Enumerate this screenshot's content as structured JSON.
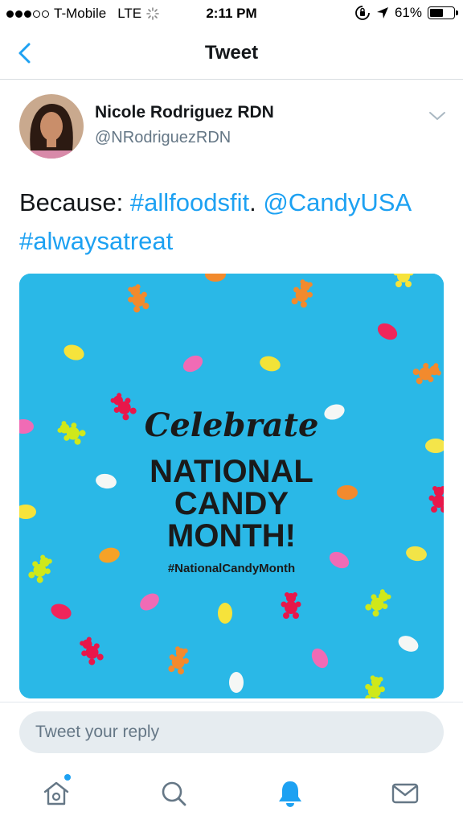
{
  "status_bar": {
    "carrier": "T-Mobile",
    "network": "LTE",
    "time": "2:11 PM",
    "battery": "61%",
    "battery_level": 0.61
  },
  "nav": {
    "title": "Tweet",
    "back_icon": "chevron-left-icon"
  },
  "tweet": {
    "display_name": "Nicole Rodriguez RDN",
    "handle": "@NRodriguezRDN",
    "text": {
      "prefix": "Because: ",
      "tag1": "#allfoodsfit",
      "sep": ". ",
      "mention": "@CandyUSA",
      "tag2": "#alwaysatreat"
    },
    "media": {
      "script_word": "Celebrate",
      "line1": "NATIONAL",
      "line2": "CANDY",
      "line3": "MONTH!",
      "hashtag": "#NationalCandyMonth",
      "background_color": "#2ab8e7"
    }
  },
  "reply": {
    "placeholder": "Tweet your reply"
  },
  "tab_bar": {
    "icons": [
      "home-icon",
      "search-icon",
      "notifications-icon",
      "messages-icon"
    ],
    "accent_color": "#1da1f2"
  }
}
